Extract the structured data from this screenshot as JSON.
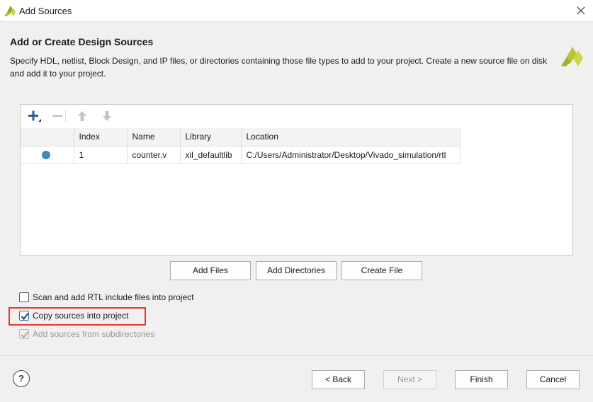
{
  "window": {
    "title": "Add Sources",
    "close_icon": "close-icon"
  },
  "header": {
    "title": "Add or Create Design Sources",
    "description": "Specify HDL, netlist, Block Design, and IP files, or directories containing those file types to add to your project. Create a new source file on disk and add it to your project.",
    "logo_icon": "vivado-logo-icon",
    "logo_color": "#b5c436"
  },
  "toolbar": {
    "icons": [
      "add-icon",
      "remove-icon",
      "move-up-icon",
      "move-down-icon"
    ]
  },
  "table": {
    "columns": [
      "",
      "Index",
      "Name",
      "Library",
      "Location"
    ],
    "rows": [
      {
        "status_color": "#3a8db5",
        "index": "1",
        "name": "counter.v",
        "library": "xil_defaultlib",
        "location": "C:/Users/Administrator/Desktop/Vivado_simulation/rtl"
      }
    ]
  },
  "actions": {
    "add_files": "Add Files",
    "add_directories": "Add Directories",
    "create_file": "Create File"
  },
  "options": {
    "scan_rtl": {
      "label": "Scan and add RTL include files into project",
      "checked": false,
      "enabled": true
    },
    "copy_sources": {
      "label": "Copy sources into project",
      "checked": true,
      "enabled": true
    },
    "subdirectories": {
      "label": "Add sources from subdirectories",
      "checked": true,
      "enabled": false
    }
  },
  "footer": {
    "help": "?",
    "back": "< Back",
    "next": "Next >",
    "finish": "Finish",
    "cancel": "Cancel"
  }
}
